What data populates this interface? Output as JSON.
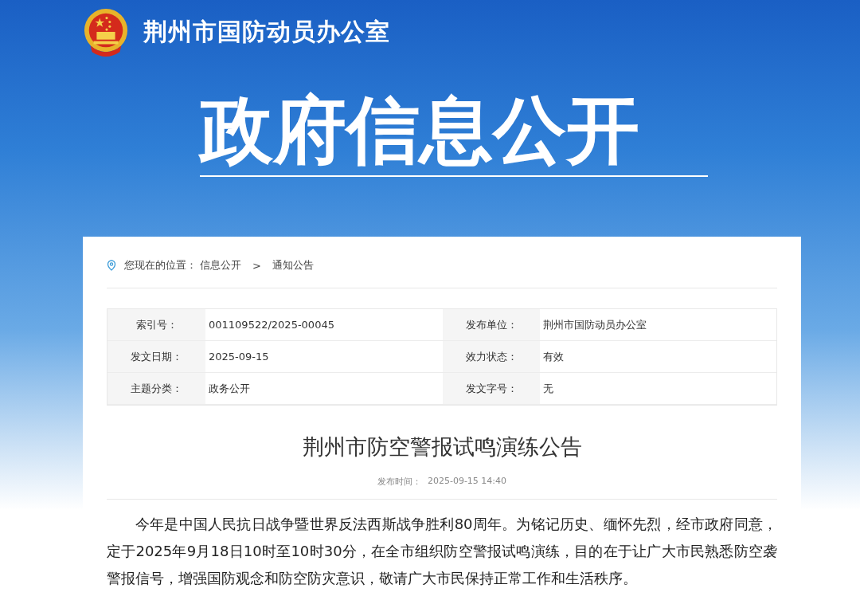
{
  "header": {
    "site_name": "荆州市国防动员办公室",
    "banner_title": "政府信息公开"
  },
  "breadcrumb": {
    "label": "您现在的位置：",
    "items": [
      "信息公开",
      "通知公告"
    ],
    "separator": ">"
  },
  "info_table": [
    {
      "label": "索引号：",
      "value": "001109522/2025-00045"
    },
    {
      "label": "发布单位：",
      "value": "荆州市国防动员办公室"
    },
    {
      "label": "发文日期：",
      "value": "2025-09-15"
    },
    {
      "label": "效力状态：",
      "value": "有效"
    },
    {
      "label": "主题分类：",
      "value": "政务公开"
    },
    {
      "label": "发文字号：",
      "value": "无"
    }
  ],
  "article": {
    "title": "荆州市防空警报试鸣演练公告",
    "publish_label": "发布时间：",
    "publish_time": "2025-09-15 14:40",
    "paragraphs": [
      "今年是中国人民抗日战争暨世界反法西斯战争胜利80周年。为铭记历史、缅怀先烈，经市政府同意，定于2025年9月18日10时至10时30分，在全市组织防空警报试鸣演练，目的在于让广大市民熟悉防空袭警报信号，增强国防观念和防空防灾意识，敬请广大市民保持正常工作和生活秩序。"
    ]
  }
}
